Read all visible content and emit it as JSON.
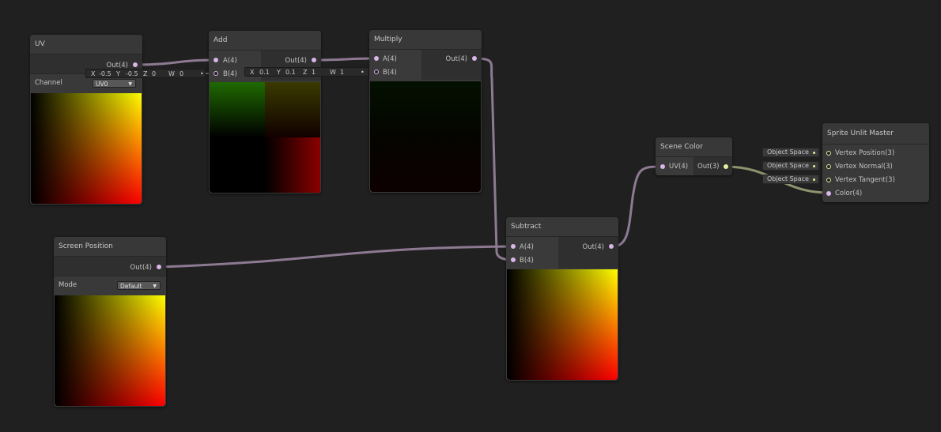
{
  "colors": {
    "background": "#202020",
    "node": "#393939",
    "wire_vector4": "#8d7a92",
    "wire_vector3": "#8e9370",
    "port_vector4": "#d9b7e8",
    "port_vector3": "#e8ef9a"
  },
  "nodes": {
    "uv": {
      "title": "UV",
      "out": "Out(4)",
      "channel_label": "Channel",
      "channel_value": "UV0"
    },
    "add": {
      "title": "Add",
      "in_a": "A(4)",
      "in_b": "B(4)",
      "out": "Out(4)"
    },
    "multiply": {
      "title": "Multiply",
      "in_a": "A(4)",
      "in_b": "B(4)",
      "out": "Out(4)"
    },
    "screen_position": {
      "title": "Screen Position",
      "out": "Out(4)",
      "mode_label": "Mode",
      "mode_value": "Default"
    },
    "subtract": {
      "title": "Subtract",
      "in_a": "A(4)",
      "in_b": "B(4)",
      "out": "Out(4)"
    },
    "scene_color": {
      "title": "Scene Color",
      "in_uv": "UV(4)",
      "out": "Out(3)"
    },
    "master": {
      "title": "Sprite Unlit Master",
      "inputs": [
        "Vertex Position(3)",
        "Vertex Normal(3)",
        "Vertex Tangent(3)",
        "Color(4)"
      ]
    }
  },
  "inline_values": {
    "add_b": {
      "x_label": "X",
      "x": "-0.5",
      "y_label": "Y",
      "y": "-0.5",
      "z_label": "Z",
      "z": "0",
      "w_label": "W",
      "w": "0"
    },
    "multiply_b": {
      "x_label": "X",
      "x": "0.1",
      "y_label": "Y",
      "y": "0.1",
      "z_label": "Z",
      "z": "1",
      "w_label": "W",
      "w": "1"
    },
    "master_space": [
      "Object Space",
      "Object Space",
      "Object Space"
    ]
  }
}
